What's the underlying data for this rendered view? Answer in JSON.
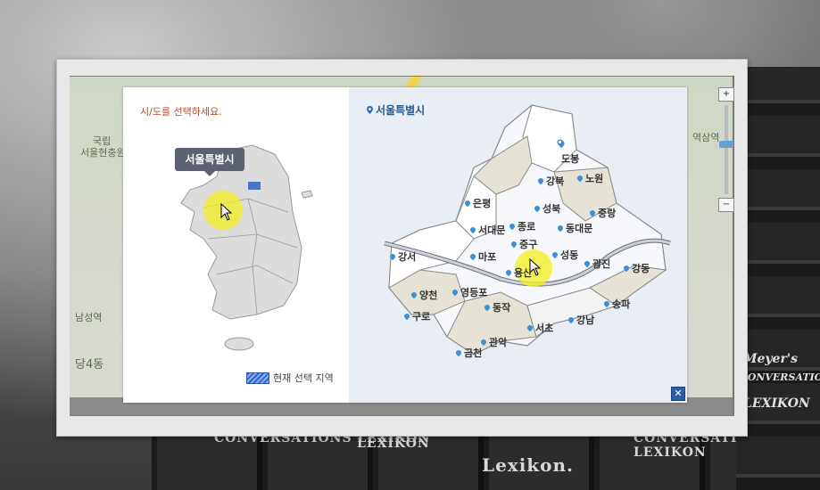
{
  "background": {
    "book_spines": [
      "CONVERSATIONS LEXIKON",
      "LEXIKON",
      "Lexikon.",
      "CONVERSATIONS LEXIKON"
    ],
    "right_book_lines": [
      "Meyer's",
      "CONVERSATIONS",
      "LEXIKON"
    ]
  },
  "map_backdrop": {
    "labels": [
      "국립",
      "서울현충원",
      "남성역",
      "역삼역",
      "당4동"
    ]
  },
  "dialog": {
    "prompt": "시/도를 선택하세요.",
    "tooltip": "서울특별시",
    "legend_label": "현재 선택 지역",
    "selected_city": "서울특별시",
    "close_label": "✕",
    "colors": {
      "accent": "#2b5fa8",
      "prompt": "#b34a2a",
      "highlight": "#f3ef1e",
      "tooltip_bg": "#5c6270"
    }
  },
  "districts": [
    {
      "name": "도봉"
    },
    {
      "name": "노원"
    },
    {
      "name": "강북"
    },
    {
      "name": "은평"
    },
    {
      "name": "성북"
    },
    {
      "name": "중랑"
    },
    {
      "name": "종로"
    },
    {
      "name": "서대문"
    },
    {
      "name": "동대문"
    },
    {
      "name": "중구"
    },
    {
      "name": "강서"
    },
    {
      "name": "마포"
    },
    {
      "name": "성동"
    },
    {
      "name": "광진"
    },
    {
      "name": "강동"
    },
    {
      "name": "용산"
    },
    {
      "name": "양천"
    },
    {
      "name": "영등포"
    },
    {
      "name": "송파"
    },
    {
      "name": "동작"
    },
    {
      "name": "구로"
    },
    {
      "name": "서초"
    },
    {
      "name": "강남"
    },
    {
      "name": "관악"
    },
    {
      "name": "금천"
    }
  ],
  "icons": [
    "map-pin-icon",
    "cursor-icon",
    "close-icon",
    "zoom-in-icon",
    "zoom-out-icon"
  ]
}
